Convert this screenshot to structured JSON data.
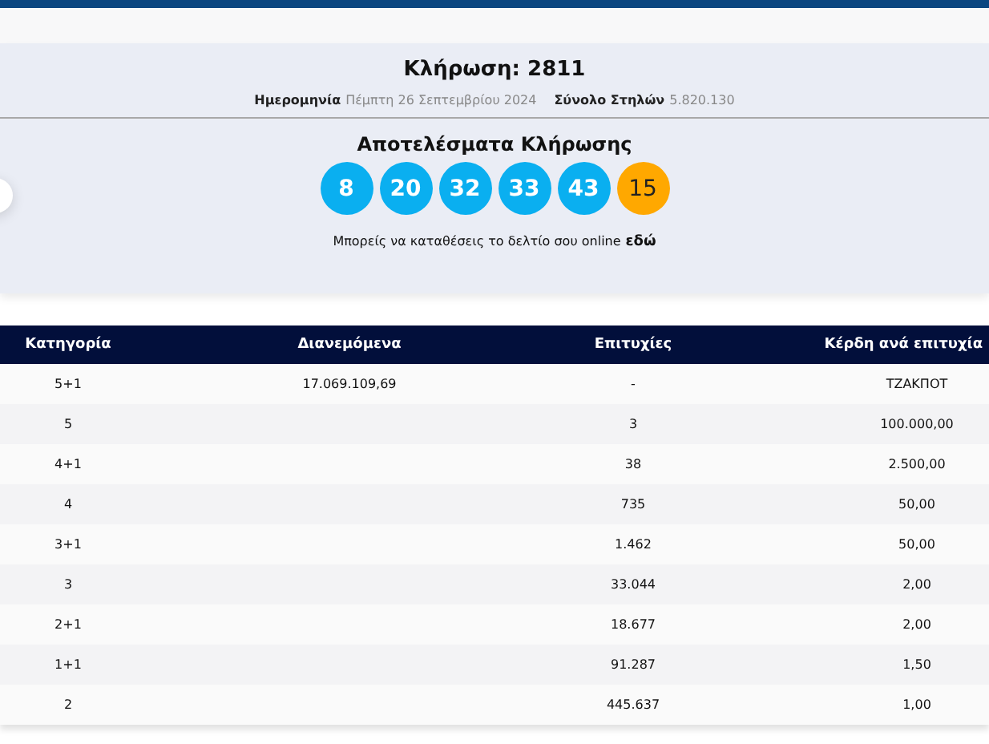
{
  "draw": {
    "title": "Κλήρωση: 2811",
    "date_label": "Ημερομηνία",
    "date_value": "Πέμπτη 26 Σεπτεμβρίου 2024",
    "columns_label": "Σύνολο Στηλών",
    "columns_value": "5.820.130"
  },
  "results": {
    "title": "Αποτελέσματα Κλήρωσης",
    "balls": [
      {
        "number": "8",
        "kind": "main"
      },
      {
        "number": "20",
        "kind": "main"
      },
      {
        "number": "32",
        "kind": "main"
      },
      {
        "number": "33",
        "kind": "main"
      },
      {
        "number": "43",
        "kind": "main"
      },
      {
        "number": "15",
        "kind": "bonus"
      }
    ],
    "online_text": "Μπορείς να καταθέσεις το δελτίο σου online",
    "online_link": "εδώ"
  },
  "table": {
    "columns": [
      "Κατηγορία",
      "Διανεμόμενα",
      "Επιτυχίες",
      "Κέρδη ανά επιτυχία"
    ],
    "rows": [
      [
        "5+1",
        "17.069.109,69",
        "-",
        "ΤΖΑΚΠΟΤ"
      ],
      [
        "5",
        "",
        "3",
        "100.000,00"
      ],
      [
        "4+1",
        "",
        "38",
        "2.500,00"
      ],
      [
        "4",
        "",
        "735",
        "50,00"
      ],
      [
        "3+1",
        "",
        "1.462",
        "50,00"
      ],
      [
        "3",
        "",
        "33.044",
        "2,00"
      ],
      [
        "2+1",
        "",
        "18.677",
        "2,00"
      ],
      [
        "1+1",
        "",
        "91.287",
        "1,50"
      ],
      [
        "2",
        "",
        "445.637",
        "1,00"
      ]
    ]
  }
}
